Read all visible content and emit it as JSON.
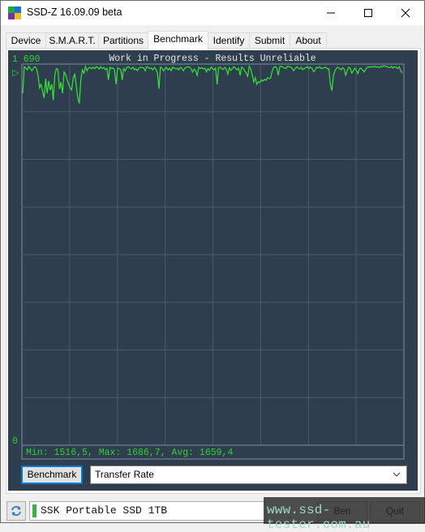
{
  "window": {
    "title": "SSD-Z 16.09.09 beta",
    "controls": {
      "minimize": "—",
      "maximize": "☐",
      "close": "✕"
    }
  },
  "tabs": [
    {
      "label": "Device",
      "active": false
    },
    {
      "label": "S.M.A.R.T.",
      "active": false
    },
    {
      "label": "Partitions",
      "active": false
    },
    {
      "label": "Benchmark",
      "active": true
    },
    {
      "label": "Identify",
      "active": false
    },
    {
      "label": "Submit",
      "active": false
    },
    {
      "label": "About",
      "active": false
    }
  ],
  "benchmark": {
    "button_label": "Benchmark",
    "mode_select": {
      "selected": "Transfer Rate"
    }
  },
  "status_bar": {
    "drive_name": "SSK Portable SSD 1TB",
    "watermark": "www.ssd-tester.com.au",
    "hidden_button_1": "Ben",
    "hidden_button_2": "Quit"
  },
  "colors": {
    "chart_bg": "#2f3e4e",
    "line": "#33e633",
    "label_green": "#2ed12e",
    "grid": "#485a6c",
    "title_text": "#e6e6e6"
  },
  "chart_data": {
    "type": "line",
    "title": "Work in Progress - Results Unreliable",
    "y_max_label": "1 690",
    "y_min_label": "0",
    "ylim": [
      0,
      1690
    ],
    "xlabel": "",
    "ylabel": "",
    "grid": true,
    "x_divisions": 8,
    "y_divisions": 8,
    "marker": "▷",
    "stats_text": "Min: 1516,5, Max: 1686,7, Avg: 1659,4",
    "stats": {
      "min": 1516.5,
      "max": 1686.7,
      "avg": 1659.4
    },
    "values": [
      1560,
      1678,
      1672,
      1665,
      1680,
      1670,
      1660,
      1672,
      1678,
      1670,
      1640,
      1585,
      1600,
      1570,
      1540,
      1625,
      1560,
      1615,
      1575,
      1600,
      1530,
      1640,
      1670,
      1665,
      1580,
      1610,
      1560,
      1655,
      1645,
      1620,
      1600,
      1585,
      1575,
      1630,
      1645,
      1595,
      1540,
      1516,
      1620,
      1665,
      1650,
      1680,
      1660,
      1672,
      1675,
      1670,
      1676,
      1670,
      1678,
      1675,
      1668,
      1678,
      1670,
      1675,
      1665,
      1672,
      1620,
      1676,
      1670,
      1673,
      1665,
      1600,
      1672,
      1670,
      1665,
      1620,
      1670,
      1660,
      1675,
      1678,
      1672,
      1668,
      1676,
      1665,
      1670,
      1660,
      1672,
      1676,
      1674,
      1673,
      1660,
      1678,
      1676,
      1670,
      1672,
      1664,
      1675,
      1668,
      1650,
      1580,
      1676,
      1672,
      1660,
      1670,
      1675,
      1664,
      1672,
      1660,
      1676,
      1672,
      1668,
      1672,
      1664,
      1676,
      1670,
      1660,
      1672,
      1675,
      1678,
      1676,
      1670,
      1654,
      1668,
      1660,
      1640,
      1676,
      1670,
      1674,
      1668,
      1672,
      1655,
      1670,
      1662,
      1676,
      1670,
      1664,
      1672,
      1600,
      1674,
      1676,
      1670,
      1666,
      1675,
      1668,
      1645,
      1674,
      1662,
      1670,
      1678,
      1672,
      1664,
      1672,
      1640,
      1676,
      1672,
      1660,
      1650,
      1635,
      1680,
      1668,
      1640,
      1610,
      1630,
      1600,
      1612,
      1608,
      1620,
      1615,
      1622,
      1618,
      1630,
      1625,
      1628,
      1660,
      1676,
      1678,
      1672,
      1640,
      1678,
      1680,
      1676,
      1672,
      1670,
      1680,
      1678,
      1676,
      1672,
      1660,
      1670,
      1678,
      1672,
      1668,
      1676,
      1665,
      1670,
      1675,
      1678,
      1670,
      1676,
      1672,
      1656,
      1662,
      1676,
      1672,
      1678,
      1670,
      1672,
      1674,
      1676,
      1668,
      1670,
      1600,
      1572,
      1640,
      1660,
      1672,
      1676,
      1670,
      1665,
      1674,
      1668,
      1640,
      1660,
      1676,
      1672,
      1650,
      1660,
      1672,
      1662,
      1648,
      1670,
      1672,
      1664,
      1655,
      1666,
      1675,
      1678,
      1676,
      1678,
      1677,
      1680,
      1676,
      1678,
      1674,
      1680,
      1678,
      1682,
      1680,
      1678,
      1676,
      1674,
      1680,
      1672,
      1678,
      1676,
      1670,
      1678,
      1660,
      1650
    ]
  }
}
